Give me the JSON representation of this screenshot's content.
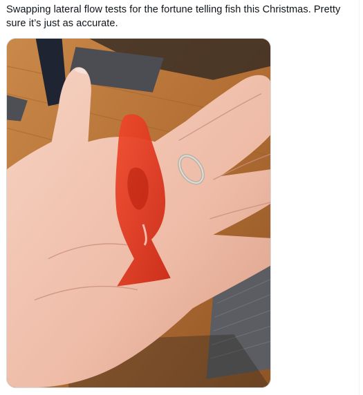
{
  "tweet": {
    "text": "Swapping lateral flow tests for the fortune telling fish this Christmas. Pretty sure it’s just as accurate."
  },
  "media": {
    "subject_icon": "fortune-fish-on-palm",
    "colors": {
      "fish": "#e8321a",
      "skin": "#f1c6b3",
      "table": "#b9763a"
    }
  }
}
